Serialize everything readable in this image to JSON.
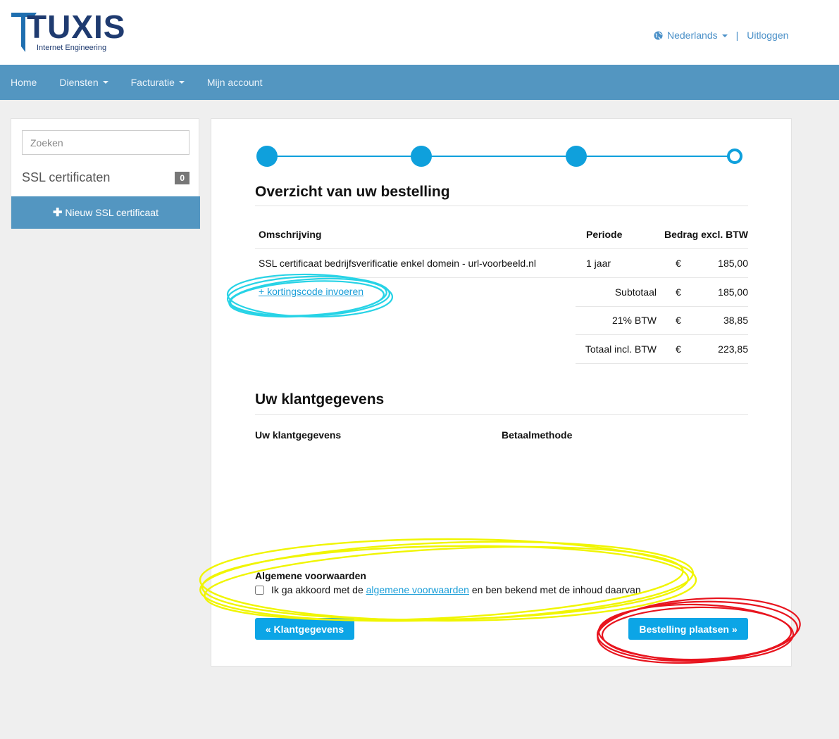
{
  "brand": {
    "name": "TUXIS",
    "tagline": "Internet Engineering"
  },
  "topbar": {
    "language": "Nederlands",
    "logout": "Uitloggen"
  },
  "nav": [
    {
      "label": "Home"
    },
    {
      "label": "Diensten"
    },
    {
      "label": "Facturatie"
    },
    {
      "label": "Mijn account"
    }
  ],
  "sidebar": {
    "search_placeholder": "Zoeken",
    "section_label": "SSL certificaten",
    "count": "0",
    "new_button": "Nieuw SSL certificaat"
  },
  "order": {
    "title": "Overzicht van uw bestelling",
    "headers": {
      "description": "Omschrijving",
      "period": "Periode",
      "amount": "Bedrag excl. BTW"
    },
    "item": {
      "description": "SSL certificaat bedrijfsverificatie enkel domein - url-voorbeeld.nl",
      "period": "1 jaar",
      "currency": "€",
      "amount": "185,00"
    },
    "discount_link": "+ kortingscode invoeren",
    "subtotal": {
      "label": "Subtotaal",
      "currency": "€",
      "amount": "185,00"
    },
    "vat": {
      "label": "21% BTW",
      "currency": "€",
      "amount": "38,85"
    },
    "total": {
      "label": "Totaal incl. BTW",
      "currency": "€",
      "amount": "223,85"
    }
  },
  "customer": {
    "title": "Uw klantgegevens",
    "col_details": "Uw klantgegevens",
    "col_payment": "Betaalmethode"
  },
  "terms": {
    "title": "Algemene voorwaarden",
    "prefix": "Ik ga akkoord met de",
    "link": "algemene voorwaarden",
    "suffix": "en ben bekend met de inhoud daarvan."
  },
  "buttons": {
    "back": "« Klantgegevens",
    "place_order": "Bestelling plaatsen »"
  },
  "colors": {
    "accent": "#0ca5e6",
    "navbar": "#5396c1",
    "annot_cyan": "#27d3e6",
    "annot_yellow": "#f0f500",
    "annot_red": "#e8141e"
  }
}
